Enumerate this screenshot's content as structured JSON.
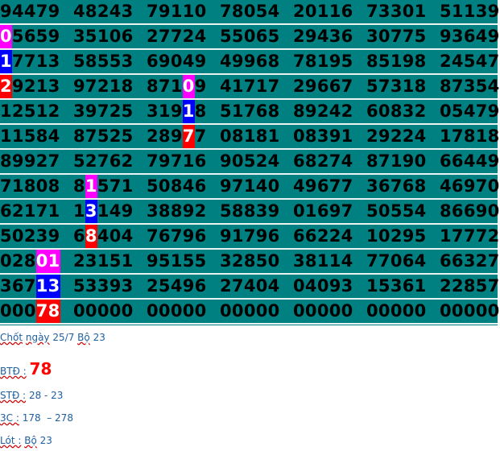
{
  "grid": {
    "rows": [
      [
        {
          "a": "94479"
        },
        {
          "a": "48243"
        },
        {
          "a": "79110"
        },
        {
          "a": "78054"
        },
        {
          "a": "20116"
        },
        {
          "a": "73301"
        },
        {
          "a": "51139"
        }
      ],
      [
        {
          "a": "",
          "h": "0",
          "b": "5659",
          "c": "magenta"
        },
        {
          "a": "35106"
        },
        {
          "a": "27724"
        },
        {
          "a": "55065"
        },
        {
          "a": "29436"
        },
        {
          "a": "30775"
        },
        {
          "a": "93649"
        }
      ],
      [
        {
          "a": "",
          "h": "1",
          "b": "7713",
          "c": "blue"
        },
        {
          "a": "58553"
        },
        {
          "a": "69049"
        },
        {
          "a": "49968"
        },
        {
          "a": "78195"
        },
        {
          "a": "85198"
        },
        {
          "a": "24547"
        }
      ],
      [
        {
          "a": "",
          "h": "2",
          "b": "9213",
          "c": "red"
        },
        {
          "a": "97218"
        },
        {
          "a": "871",
          "h": "0",
          "b": "9",
          "c": "magenta"
        },
        {
          "a": "41717"
        },
        {
          "a": "29667"
        },
        {
          "a": "57318"
        },
        {
          "a": "87354"
        }
      ],
      [
        {
          "a": "12512"
        },
        {
          "a": "39725"
        },
        {
          "a": "319",
          "h": "1",
          "b": "8",
          "c": "blue"
        },
        {
          "a": "51768"
        },
        {
          "a": "89242"
        },
        {
          "a": "60832"
        },
        {
          "a": "05479"
        }
      ],
      [
        {
          "a": "11584"
        },
        {
          "a": "87525"
        },
        {
          "a": "289",
          "h": "7",
          "b": "7",
          "c": "red"
        },
        {
          "a": "08181"
        },
        {
          "a": "08391"
        },
        {
          "a": "29224"
        },
        {
          "a": "17818"
        }
      ],
      [
        {
          "a": "89927"
        },
        {
          "a": "52762"
        },
        {
          "a": "79716"
        },
        {
          "a": "90524"
        },
        {
          "a": "68274"
        },
        {
          "a": "87190"
        },
        {
          "a": "66449"
        }
      ],
      [
        {
          "a": "71808"
        },
        {
          "a": "8",
          "h": "1",
          "b": "571",
          "c": "magenta"
        },
        {
          "a": "50846"
        },
        {
          "a": "97140"
        },
        {
          "a": "49677"
        },
        {
          "a": "36768"
        },
        {
          "a": "46970"
        }
      ],
      [
        {
          "a": "62171"
        },
        {
          "a": "1",
          "h": "3",
          "b": "149",
          "c": "blue"
        },
        {
          "a": "38892"
        },
        {
          "a": "58839"
        },
        {
          "a": "01697"
        },
        {
          "a": "50554"
        },
        {
          "a": "86690"
        }
      ],
      [
        {
          "a": "50239"
        },
        {
          "a": "6",
          "h": "8",
          "b": "404",
          "c": "red"
        },
        {
          "a": "76796"
        },
        {
          "a": "91796"
        },
        {
          "a": "66224"
        },
        {
          "a": "10295"
        },
        {
          "a": "17772"
        }
      ],
      [
        {
          "a": "028",
          "h": "01",
          "b": "",
          "c": "magenta"
        },
        {
          "a": "23151"
        },
        {
          "a": "95155"
        },
        {
          "a": "32850"
        },
        {
          "a": "38114"
        },
        {
          "a": "77064"
        },
        {
          "a": "66327"
        }
      ],
      [
        {
          "a": "367",
          "h": "13",
          "b": "",
          "c": "blue"
        },
        {
          "a": "53393"
        },
        {
          "a": "25496"
        },
        {
          "a": "27404"
        },
        {
          "a": "04093"
        },
        {
          "a": "15361"
        },
        {
          "a": "22857"
        }
      ],
      [
        {
          "a": "000",
          "h": "78",
          "b": "",
          "c": "red"
        },
        {
          "a": "00000"
        },
        {
          "a": "00000"
        },
        {
          "a": "00000"
        },
        {
          "a": "00000"
        },
        {
          "a": "00000"
        },
        {
          "a": "00000"
        }
      ]
    ]
  },
  "notes": {
    "chot_prefix": "Chốt",
    "chot_ngay": "ngày",
    "chot_date": "25/7",
    "chot_bo": "Bộ",
    "chot_num": "23",
    "btd_label": "BTĐ :",
    "btd_value": "78",
    "std_label": "STĐ :",
    "std_value": "28 - 23",
    "threec_label": "3C :",
    "threec_value": "178  – 278",
    "lot_label": "Lót :",
    "lot_bo": "Bộ",
    "lot_value": "23"
  },
  "colors": {
    "grid_bg": "#008080",
    "magenta": "#ff00ff",
    "blue": "#0000ff",
    "red": "#ff0000",
    "note_text": "#1f5fa0"
  }
}
